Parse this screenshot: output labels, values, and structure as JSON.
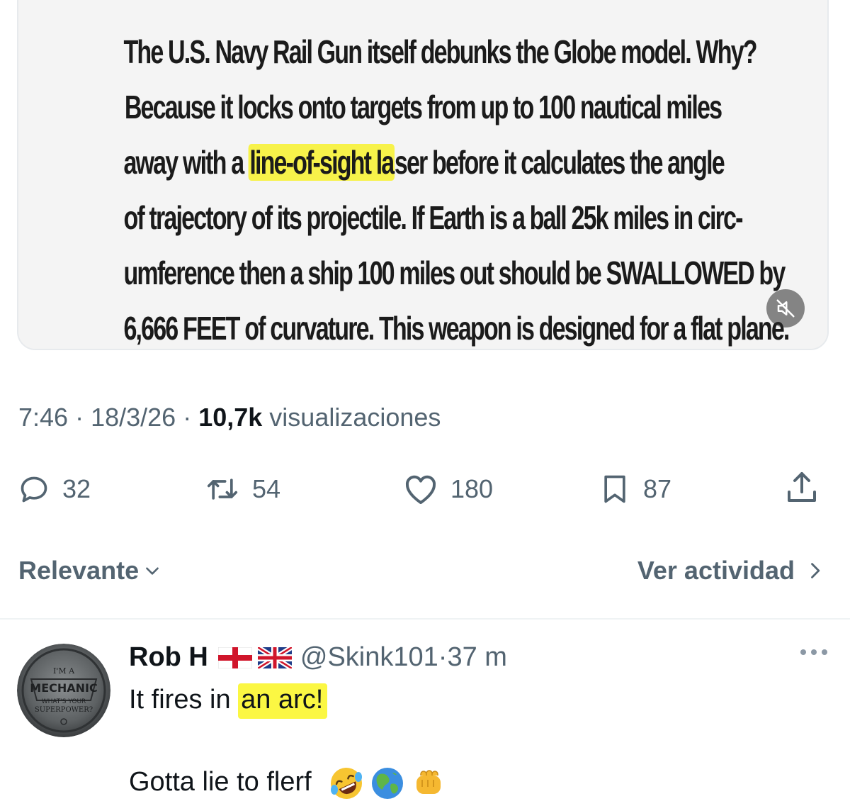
{
  "media": {
    "lines": [
      "The U.S. Navy Rail Gun itself debunks the Globe model.  Why?",
      "Because it locks onto targets from up to 100 nautical miles",
      "of trajectory of its projectile.  If Earth is a ball 25k miles in circ-",
      "umference then a ship 100 miles out should be SWALLOWED by",
      "6,666 FEET of curvature.  This weapon is designed for a flat plane."
    ],
    "line3_before": "away with a ",
    "line3_highlight": "line-of-sight la",
    "line3_after": "ser before it calculates the angle",
    "highlight_color": "#f7f24a",
    "mute_icon": "volume-muted-icon"
  },
  "meta": {
    "time": "7:46",
    "sep1": " · ",
    "date": "18/3/26",
    "sep2": " · ",
    "views_count": "10,7k",
    "views_label": " visualizaciones"
  },
  "actions": {
    "replies": "32",
    "reposts": "54",
    "likes": "180",
    "bookmarks": "87",
    "icons": [
      "reply-icon",
      "repost-icon",
      "like-icon",
      "bookmark-icon",
      "share-icon"
    ]
  },
  "sort": {
    "label": "Relevante",
    "activity_label": "Ver actividad"
  },
  "reply": {
    "name": "Rob H",
    "flags": [
      "england-flag",
      "uk-flag"
    ],
    "handle": "@Skink101",
    "sep": " · ",
    "time": "37 m",
    "line1_before": "It fires in ",
    "line1_highlight": "an arc!",
    "line2": "Gotta lie to flerf",
    "emojis": [
      "rofl-emoji",
      "globe-emoji",
      "fist-emoji"
    ],
    "avatar_text": [
      "I'M A",
      "MECHANIC",
      "WHAT'S YOUR",
      "SUPERPOWER?"
    ]
  },
  "colors": {
    "secondary_text": "#536471",
    "primary_text": "#0f1419",
    "highlight": "#fbf743"
  }
}
